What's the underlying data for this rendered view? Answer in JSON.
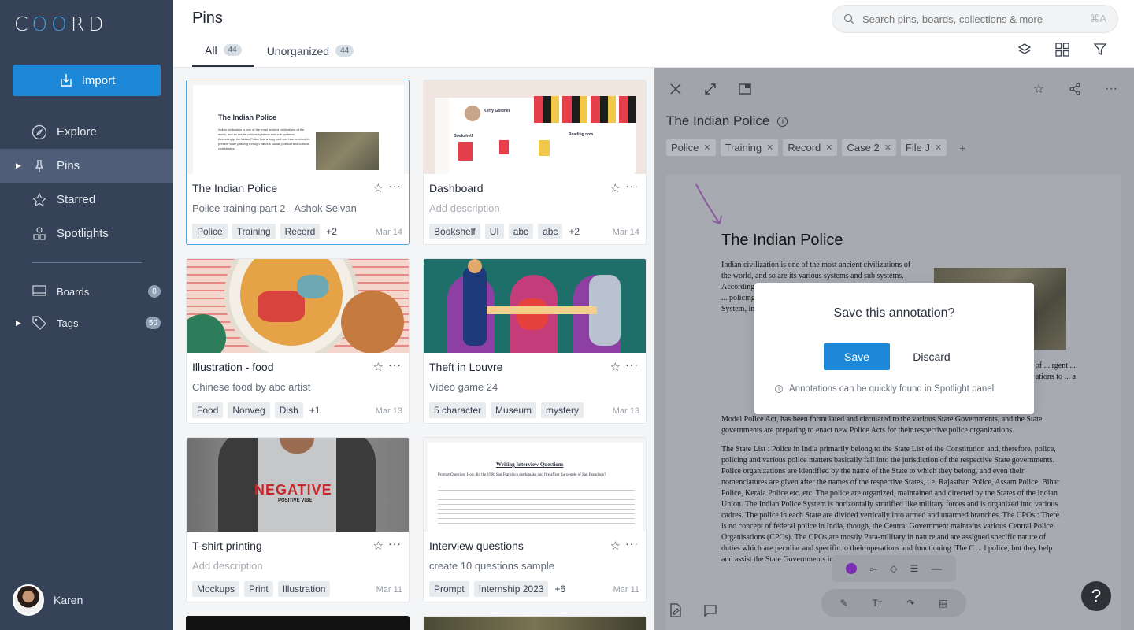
{
  "sidebar": {
    "logo": "COORD",
    "import_label": "Import",
    "nav": [
      {
        "label": "Explore",
        "icon": "compass-icon"
      },
      {
        "label": "Pins",
        "icon": "pin-icon"
      },
      {
        "label": "Starred",
        "icon": "star-icon"
      },
      {
        "label": "Spotlights",
        "icon": "spotlights-icon"
      }
    ],
    "boards": {
      "label": "Boards",
      "count": "0"
    },
    "tags": {
      "label": "Tags",
      "count": "50"
    },
    "user": "Karen"
  },
  "header": {
    "title": "Pins",
    "tabs": [
      {
        "label": "All",
        "count": "44"
      },
      {
        "label": "Unorganized",
        "count": "44"
      }
    ],
    "search_placeholder": "Search pins, boards, collections & more",
    "search_shortcut": "⌘A"
  },
  "cards": [
    {
      "title": "The Indian Police",
      "desc": "Police training part 2 - Ashok Selvan",
      "tags": [
        "Police",
        "Training",
        "Record"
      ],
      "more": "+2",
      "date": "Mar 14"
    },
    {
      "title": "Dashboard",
      "desc": "Add description",
      "tags": [
        "Bookshelf",
        "UI",
        "abc",
        "abc"
      ],
      "more": "+2",
      "date": "Mar 14"
    },
    {
      "title": "Illustration - food",
      "desc": "Chinese food by abc artist",
      "tags": [
        "Food",
        "Nonveg",
        "Dish"
      ],
      "more": "+1",
      "date": "Mar 13"
    },
    {
      "title": "Theft in Louvre",
      "desc": "Video game 24",
      "tags": [
        "5 character",
        "Museum",
        "mystery"
      ],
      "more": "",
      "date": "Mar 13"
    },
    {
      "title": "T-shirt printing",
      "desc": "Add description",
      "tags": [
        "Mockups",
        "Print",
        "Illustration"
      ],
      "more": "",
      "date": "Mar 11"
    },
    {
      "title": "Interview questions",
      "desc": "create 10 questions sample",
      "tags": [
        "Prompt",
        "Internship 2023"
      ],
      "more": "+6",
      "date": "Mar 11"
    }
  ],
  "thumbs": {
    "police_title": "The Indian Police",
    "police_text": "Indian civilization is one of the most ancient civilizations of the world, and so are its various systems and sub systems. Accordingly, the Indian Police has a long past and has reached its present state passing through various social, political and cultural vicissitudes.",
    "dashboard_user": "Kerry Goldner",
    "dashboard_shelf": "Bookshelf",
    "dashboard_reading": "Reading now",
    "tshirt_text": "NEGATIVE",
    "tshirt_sub": "POSITIVE VIBE",
    "interview_heading": "Writing Interview Questions",
    "interview_prompt": "Prompt Question: How did the 1906 San Francisco earthquake and fire affect the people of San Francisco?"
  },
  "detail": {
    "title": "The Indian Police",
    "tags": [
      "Police",
      "Training",
      "Record",
      "Case 2",
      "File J"
    ],
    "doc_title": "The Indian Police",
    "doc_p1": "Indian civilization is one of the most ancient civilizations of the world, and so are its various systems and sub systems. According ... reached it ... political a ... in India ap ... various fe ... policing sy ... functional ... Enactmen ... of the prese ... System, in ... need to re ... to the Cent ...",
    "doc_p1_right": "dation of ... rgent ... ations to ... a",
    "doc_p1_end": "Model Police Act, has been formulated and circulated to the various State Governments, and the State governments are preparing to enact new Police Acts for their respective police organizations.",
    "doc_p2": "The State List : Police in India primarily belong to the State List of the Constitution and, therefore, police, policing and various police matters basically fall into the jurisdiction of the respective State governments. Police organizations are identified by the name of the State to which they belong, and even their nomenclatures are given after the names of the respective States, i.e. Rajasthan Police, Assam Police, Bihar Police, Kerala Police etc.,etc. The police are organized, maintained and directed by the States of the Indian Union. The Indian Police System is horizontally stratified like military forces and is organized into various cadres. The police in each State are divided vertically into armed and unarmed branches. The CPOs : There is no concept of federal police in India, though, the Central Government maintains various Central Police Organisations (CPOs). The CPOs are mostly Para-military in nature and are assigned specific nature of duties which are peculiar and specific to their operations and functioning. The C ... l police, but they help and assist the State Governments in excep",
    "modal": {
      "title": "Save this annotation?",
      "save": "Save",
      "discard": "Discard",
      "note": "Annotations can be quickly found in Spotlight panel"
    },
    "help": "?"
  }
}
